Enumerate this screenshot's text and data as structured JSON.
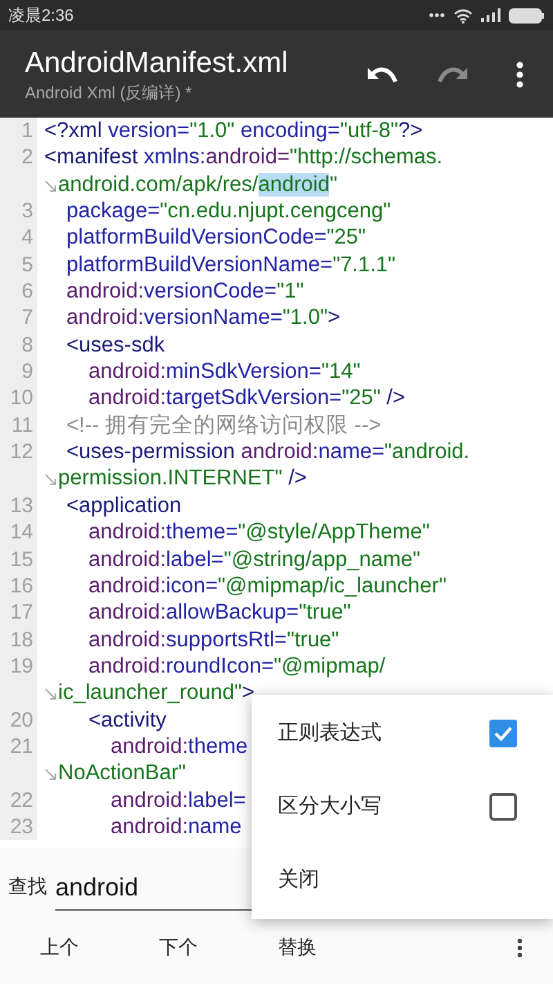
{
  "status_bar": {
    "time": "凌晨2:36"
  },
  "toolbar": {
    "title": "AndroidManifest.xml",
    "subtitle": "Android Xml (反编详) *",
    "actions": [
      {
        "kind": "undo",
        "disabled": false
      },
      {
        "kind": "redo",
        "disabled": true
      },
      {
        "kind": "more",
        "disabled": false
      }
    ]
  },
  "editor": {
    "lines": [
      {
        "number": "1",
        "segments": [
          {
            "kind": "tag",
            "text": "<?xml"
          },
          {
            "kind": "attr",
            "text": " version="
          },
          {
            "kind": "value",
            "text": "\"1.0\""
          },
          {
            "kind": "attr",
            "text": " encoding="
          },
          {
            "kind": "value",
            "text": "\"utf-8\""
          },
          {
            "kind": "tag",
            "text": "?>"
          }
        ]
      },
      {
        "number": "2",
        "segments": [
          {
            "kind": "tag",
            "text": "<manifest"
          },
          {
            "kind": "attr",
            "text": " xmlns:"
          },
          {
            "kind": "ns",
            "text": "android="
          },
          {
            "kind": "value",
            "text": "\"http://schemas."
          }
        ],
        "wrap": [
          {
            "kind": "value",
            "text": "android.com/apk/res/"
          },
          {
            "kind": "match",
            "text": "android"
          },
          {
            "kind": "value",
            "text": "\""
          }
        ],
        "children": [
          {
            "number": "3",
            "segments": [
              {
                "kind": "attr",
                "text": "package="
              },
              {
                "kind": "value",
                "text": "\"cn.edu.njupt.cengceng\""
              }
            ]
          },
          {
            "number": "4",
            "segments": [
              {
                "kind": "attr",
                "text": "platformBuildVersionCode="
              },
              {
                "kind": "value",
                "text": "\"25\""
              }
            ]
          },
          {
            "number": "5",
            "segments": [
              {
                "kind": "attr",
                "text": "platformBuildVersionName="
              },
              {
                "kind": "value",
                "text": "\"7.1.1\""
              }
            ]
          },
          {
            "number": "6",
            "segments": [
              {
                "kind": "ns",
                "text": "android:"
              },
              {
                "kind": "attr",
                "text": "versionCode="
              },
              {
                "kind": "value",
                "text": "\"1\""
              }
            ]
          },
          {
            "number": "7",
            "segments": [
              {
                "kind": "ns",
                "text": "android:"
              },
              {
                "kind": "attr",
                "text": "versionName="
              },
              {
                "kind": "value",
                "text": "\"1.0\""
              },
              {
                "kind": "tag",
                "text": ">"
              }
            ]
          },
          {
            "number": "8",
            "segments": [
              {
                "kind": "tag",
                "text": "<uses-sdk"
              }
            ],
            "children": [
              {
                "number": "9",
                "segments": [
                  {
                    "kind": "ns",
                    "text": "android:"
                  },
                  {
                    "kind": "attr",
                    "text": "minSdkVersion="
                  },
                  {
                    "kind": "value",
                    "text": "\"14\""
                  }
                ]
              },
              {
                "number": "10",
                "segments": [
                  {
                    "kind": "ns",
                    "text": "android:"
                  },
                  {
                    "kind": "attr",
                    "text": "targetSdkVersion="
                  },
                  {
                    "kind": "value",
                    "text": "\"25\""
                  },
                  {
                    "kind": "tag",
                    "text": " />"
                  }
                ]
              }
            ]
          },
          {
            "number": "11",
            "segments": [
              {
                "kind": "comment",
                "text": "<!-- 拥有完全的网络访问权限 -->"
              }
            ]
          },
          {
            "number": "12",
            "segments": [
              {
                "kind": "tag",
                "text": "<uses-permission "
              },
              {
                "kind": "ns",
                "text": "android:"
              },
              {
                "kind": "attr",
                "text": "name="
              },
              {
                "kind": "value",
                "text": "\"android."
              }
            ],
            "wrap": [
              {
                "kind": "value",
                "text": "permission.INTERNET\""
              },
              {
                "kind": "tag",
                "text": " />"
              }
            ]
          },
          {
            "number": "13",
            "segments": [
              {
                "kind": "tag",
                "text": "<application"
              }
            ],
            "children": [
              {
                "number": "14",
                "segments": [
                  {
                    "kind": "ns",
                    "text": "android:"
                  },
                  {
                    "kind": "attr",
                    "text": "theme="
                  },
                  {
                    "kind": "value",
                    "text": "\"@style/AppTheme\""
                  }
                ]
              },
              {
                "number": "15",
                "segments": [
                  {
                    "kind": "ns",
                    "text": "android:"
                  },
                  {
                    "kind": "attr",
                    "text": "label="
                  },
                  {
                    "kind": "value",
                    "text": "\"@string/app_name\""
                  }
                ]
              },
              {
                "number": "16",
                "segments": [
                  {
                    "kind": "ns",
                    "text": "android:"
                  },
                  {
                    "kind": "attr",
                    "text": "icon="
                  },
                  {
                    "kind": "value",
                    "text": "\"@mipmap/ic_launcher\""
                  }
                ]
              },
              {
                "number": "17",
                "segments": [
                  {
                    "kind": "ns",
                    "text": "android:"
                  },
                  {
                    "kind": "attr",
                    "text": "allowBackup="
                  },
                  {
                    "kind": "value",
                    "text": "\"true\""
                  }
                ]
              },
              {
                "number": "18",
                "segments": [
                  {
                    "kind": "ns",
                    "text": "android:"
                  },
                  {
                    "kind": "attr",
                    "text": "supportsRtl="
                  },
                  {
                    "kind": "value",
                    "text": "\"true\""
                  }
                ]
              },
              {
                "number": "19",
                "segments": [
                  {
                    "kind": "ns",
                    "text": "android:"
                  },
                  {
                    "kind": "attr",
                    "text": "roundIcon="
                  },
                  {
                    "kind": "value",
                    "text": "\"@mipmap/"
                  }
                ],
                "wrap": [
                  {
                    "kind": "value",
                    "text": "ic_launcher_round\""
                  },
                  {
                    "kind": "tag",
                    "text": ">"
                  }
                ]
              },
              {
                "number": "20",
                "segments": [
                  {
                    "kind": "tag",
                    "text": "<activity"
                  }
                ],
                "children": [
                  {
                    "number": "21",
                    "segments": [
                      {
                        "kind": "ns",
                        "text": "android:"
                      },
                      {
                        "kind": "attr",
                        "text": "theme"
                      }
                    ],
                    "wrap": [
                      {
                        "kind": "value",
                        "text": "NoActionBar\""
                      }
                    ]
                  },
                  {
                    "number": "22",
                    "segments": [
                      {
                        "kind": "ns",
                        "text": "android:"
                      },
                      {
                        "kind": "attr",
                        "text": "label="
                      }
                    ]
                  },
                  {
                    "number": "23",
                    "segments": [
                      {
                        "kind": "ns",
                        "text": "android:"
                      },
                      {
                        "kind": "attr",
                        "text": "name"
                      }
                    ]
                  }
                ]
              }
            ]
          }
        ]
      }
    ]
  },
  "find_bar": {
    "label": "查找",
    "value": "android",
    "buttons": [
      {
        "kind": "text",
        "label": "上个"
      },
      {
        "kind": "text",
        "label": "下个"
      },
      {
        "kind": "text",
        "label": "替换"
      },
      {
        "kind": "more"
      }
    ]
  },
  "menu": {
    "items": [
      {
        "kind": "checkbox",
        "label": "正则表达式",
        "checked": true
      },
      {
        "kind": "checkbox",
        "label": "区分大小写",
        "checked": false
      },
      {
        "kind": "action",
        "label": "关闭"
      }
    ]
  }
}
